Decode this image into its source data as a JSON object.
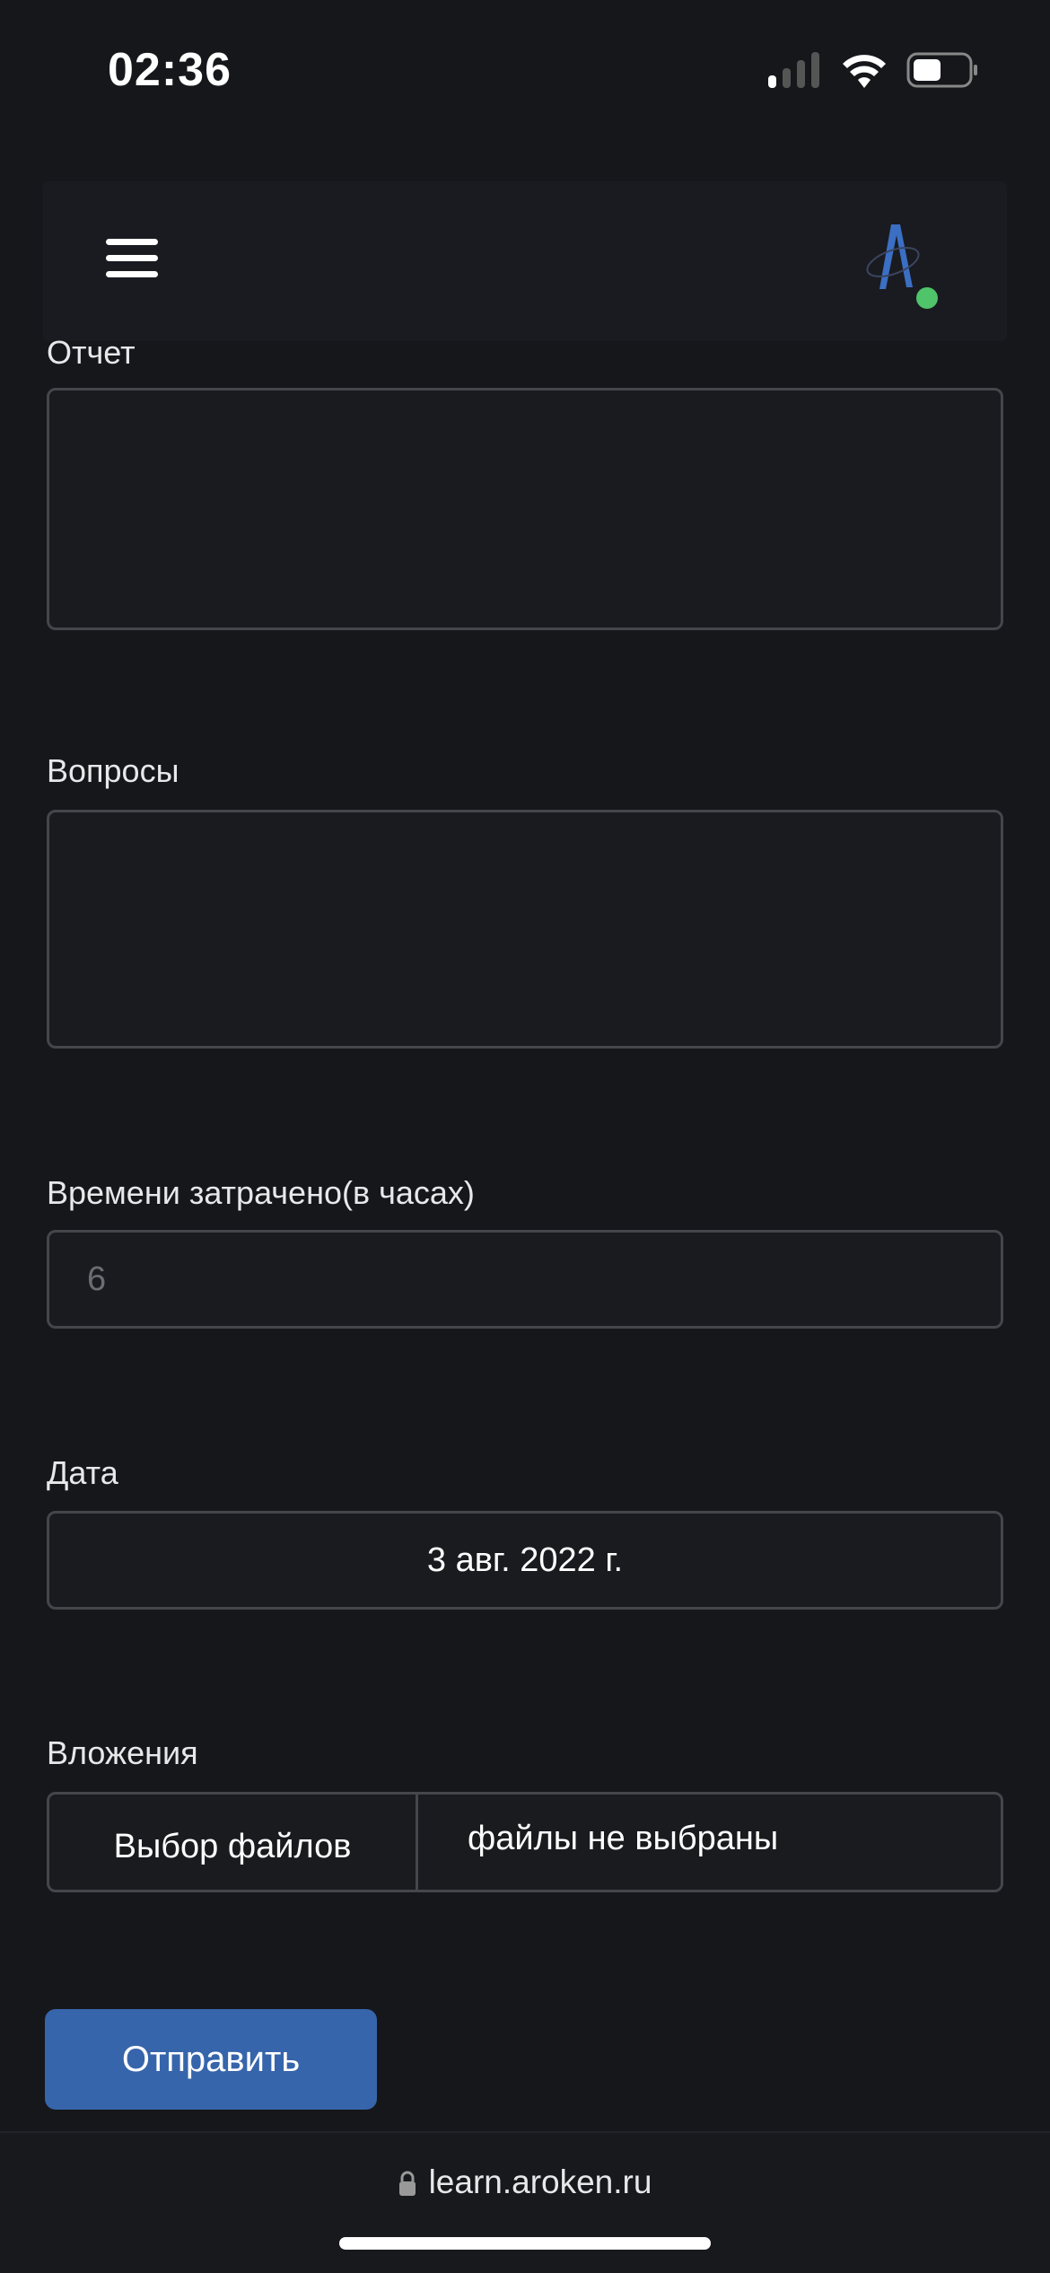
{
  "status_bar": {
    "time": "02:36"
  },
  "header": {
    "menu_icon": "hamburger-icon",
    "logo": "A"
  },
  "form": {
    "report": {
      "label": "Отчет",
      "value": ""
    },
    "questions": {
      "label": "Вопросы",
      "value": ""
    },
    "time_spent": {
      "label": "Времени затрачено(в часах)",
      "placeholder": "6"
    },
    "date": {
      "label": "Дата",
      "value": "3 авг. 2022 г."
    },
    "attachments": {
      "label": "Вложения",
      "choose_button": "Выбор файлов",
      "status": "файлы не выбраны"
    },
    "submit_label": "Отправить"
  },
  "browser": {
    "url": "learn.aroken.ru"
  },
  "colors": {
    "background": "#16171b",
    "accent": "#3765ab",
    "online": "#4fc46a"
  }
}
